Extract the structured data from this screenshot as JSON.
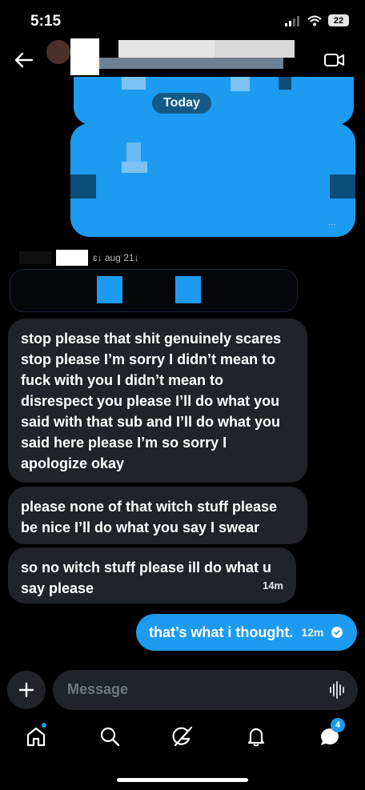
{
  "status_bar": {
    "time": "5:15",
    "battery": "22"
  },
  "header": {
    "back_icon": "arrow-left-icon",
    "video_icon": "video-call-icon"
  },
  "divider": {
    "label": "Today"
  },
  "reply_context": {
    "label": "ɛ↓ aug 21↓"
  },
  "messages": [
    {
      "text": "stop please that shit genuinely scares stop please I’m sorry I didn’t mean to fuck with you I didn’t mean to disrespect you please I’ll do what you said with that sub and I’ll do what you said here please I’m so sorry I apologize okay"
    },
    {
      "text": "please none of that witch stuff please be nice I’ll do what you say I swear"
    },
    {
      "text": "so no witch stuff please ill do what u say please",
      "time": "14m"
    }
  ],
  "sent_message": {
    "text": "that’s what i thought.",
    "time": "12m"
  },
  "composer": {
    "placeholder": "Message"
  },
  "tab_bar": {
    "messages_badge": "4"
  },
  "colors": {
    "accent": "#1d9bf0",
    "bubble": "#202327",
    "background": "#000000"
  }
}
